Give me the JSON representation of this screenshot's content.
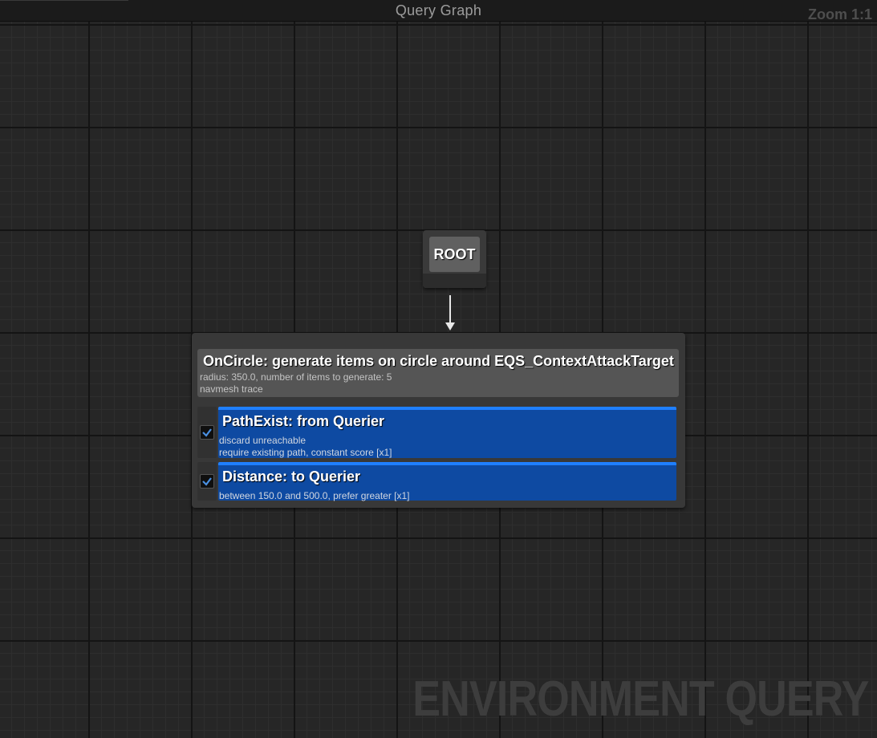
{
  "window": {
    "title": "Query Graph",
    "zoom": "Zoom 1:1",
    "watermark": "ENVIRONMENT QUERY"
  },
  "root_node": {
    "label": "ROOT"
  },
  "generator": {
    "title": "OnCircle: generate items on circle around EQS_ContextAttackTarget",
    "details": [
      "radius: 350.0, number of items to generate: 5",
      "navmesh trace"
    ]
  },
  "tests": [
    {
      "title": "PathExist: from Querier",
      "enabled": true,
      "details": [
        "discard unreachable",
        "require existing path, constant score [x1]"
      ]
    },
    {
      "title": "Distance: to Querier",
      "enabled": true,
      "details": [
        "between 150.0 and 500.0, prefer greater [x1]"
      ]
    }
  ],
  "colors": {
    "background": "#262626",
    "test_fill": "#0e4aa2",
    "test_accent": "#1f7fff",
    "check": "#4a90e2"
  },
  "icons": {
    "checkbox": "check-icon",
    "connector": "arrow-down-icon"
  }
}
